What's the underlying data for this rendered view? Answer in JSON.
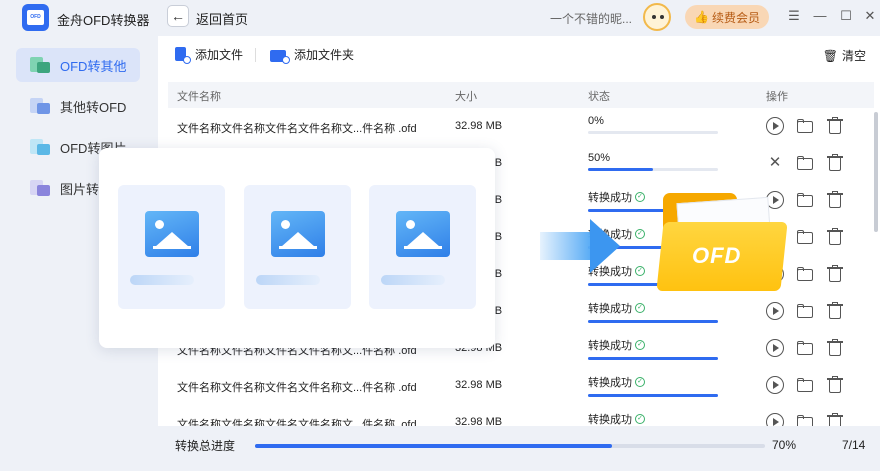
{
  "app": {
    "title": "金舟OFD转换器",
    "logo_text": "OFD",
    "back_label": "返回首页"
  },
  "header": {
    "promo_text": "一个不错的昵...",
    "member_label": "续费会员"
  },
  "sidebar": {
    "items": [
      {
        "label": "OFD转其他"
      },
      {
        "label": "其他转OFD"
      },
      {
        "label": "OFD转图片"
      },
      {
        "label": "图片转OFD"
      }
    ]
  },
  "toolbar": {
    "add_file": "添加文件",
    "add_folder": "添加文件夹",
    "clear": "清空"
  },
  "table": {
    "headers": {
      "name": "文件名称",
      "size": "大小",
      "status": "状态",
      "actions": "操作"
    },
    "rows": [
      {
        "name": "文件名称文件名称文件名文件名称文...件名称 .ofd",
        "size": "32.98 MB",
        "status": "0%",
        "progress": 0,
        "state": "pending"
      },
      {
        "name": "文件名称文件名称文件名文件名称文...件名称 .ofd",
        "size": "32.98 MB",
        "status": "50%",
        "progress": 0.5,
        "state": "converting"
      },
      {
        "name": "文件名称文件名称文件名文件名称文...件名称 .ofd",
        "size": "32.98 MB",
        "status": "转换成功",
        "progress": 1,
        "state": "done"
      },
      {
        "name": "文件名称文件名称文件名文件名称文...件名称 .ofd",
        "size": "32.98 MB",
        "status": "转换成功",
        "progress": 1,
        "state": "done"
      },
      {
        "name": "文件名称文件名称文件名文件名称文...件名称 .ofd",
        "size": "32.98 MB",
        "status": "转换成功",
        "progress": 1,
        "state": "done"
      },
      {
        "name": "文件名称文件名称文件名文件名称文...件名称 .ofd",
        "size": "32.98 MB",
        "status": "转换成功",
        "progress": 1,
        "state": "done"
      },
      {
        "name": "文件名称文件名称文件名文件名称文...件名称 .ofd",
        "size": "32.98 MB",
        "status": "转换成功",
        "progress": 1,
        "state": "done"
      },
      {
        "name": "文件名称文件名称文件名文件名称文...件名称 .ofd",
        "size": "32.98 MB",
        "status": "转换成功",
        "progress": 1,
        "state": "done"
      },
      {
        "name": "文件名称文件名称文件名文件名称文...件名称 .ofd",
        "size": "32.98 MB",
        "status": "转换成功",
        "progress": 1,
        "state": "done"
      }
    ]
  },
  "footer": {
    "label": "转换总进度",
    "percent_text": "70%",
    "progress": 0.7,
    "count_text": "7/14"
  },
  "illustration": {
    "badge_text": "OFD"
  },
  "colors": {
    "accent": "#2f6bf0",
    "member_bg": "#f9d7b5",
    "folder": "#ffc210",
    "success": "#3bb16a"
  }
}
